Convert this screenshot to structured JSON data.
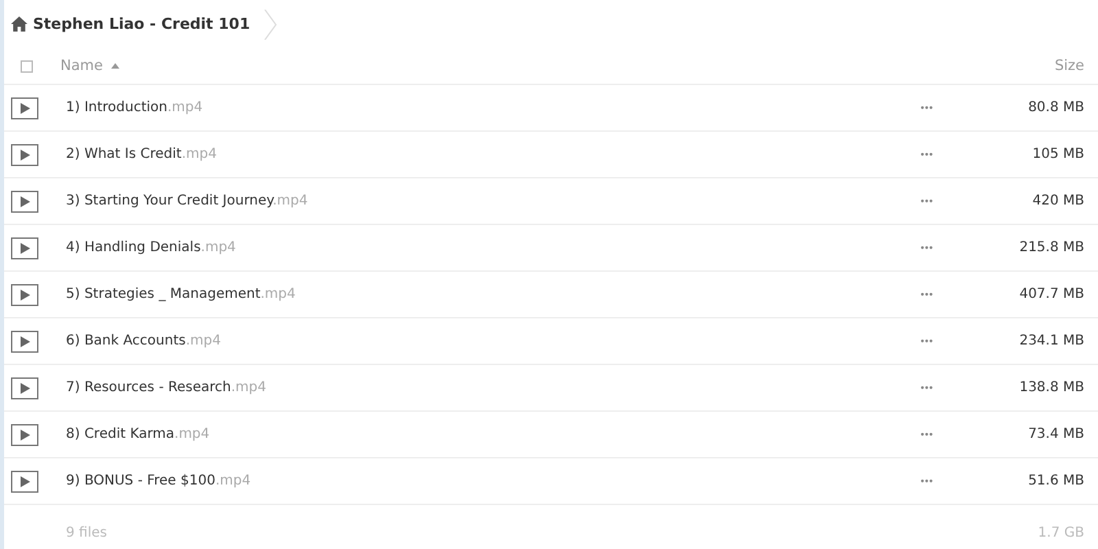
{
  "breadcrumb": {
    "title": "Stephen Liao - Credit 101"
  },
  "table": {
    "columns": [
      {
        "label": "Name",
        "sorted": true
      },
      {
        "label": "Size"
      }
    ],
    "select_all": {
      "checked": false
    },
    "rows": [
      {
        "name": "1) Introduction",
        "ext": ".mp4",
        "more": "•••",
        "size": "80.8 MB"
      },
      {
        "name": "2) What Is Credit",
        "ext": ".mp4",
        "more": "•••",
        "size": "105 MB"
      },
      {
        "name": "3) Starting Your Credit Journey",
        "ext": ".mp4",
        "more": "•••",
        "size": "420 MB"
      },
      {
        "name": "4) Handling Denials",
        "ext": ".mp4",
        "more": "•••",
        "size": "215.8 MB"
      },
      {
        "name": "5) Strategies _ Management",
        "ext": ".mp4",
        "more": "•••",
        "size": "407.7 MB"
      },
      {
        "name": "6) Bank Accounts",
        "ext": ".mp4",
        "more": "•••",
        "size": "234.1 MB"
      },
      {
        "name": "7) Resources - Research",
        "ext": ".mp4",
        "more": "•••",
        "size": "138.8 MB"
      },
      {
        "name": "8) Credit Karma",
        "ext": ".mp4",
        "more": "•••",
        "size": "73.4 MB"
      },
      {
        "name": "9) BONUS - Free $100",
        "ext": ".mp4",
        "more": "•••",
        "size": "51.6 MB"
      }
    ]
  },
  "footer": {
    "count": "9 files",
    "total": "1.7 GB"
  }
}
